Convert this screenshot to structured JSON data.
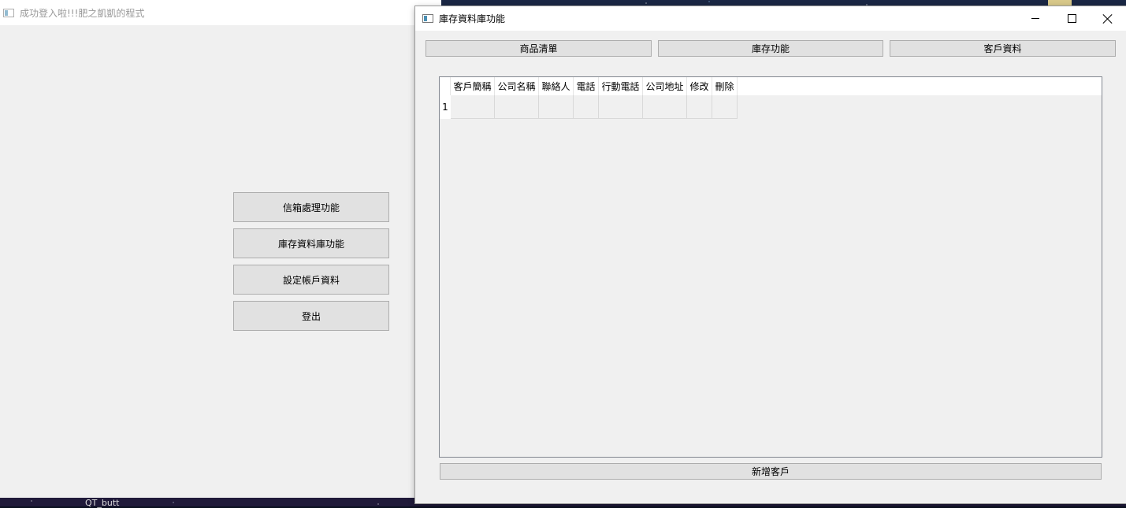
{
  "back_window": {
    "title": "成功登入啦!!!肥之凱凱的程式",
    "buttons": [
      "信箱處理功能",
      "庫存資料庫功能",
      "設定帳戶資料",
      "登出"
    ]
  },
  "front_window": {
    "title": "庫存資料庫功能",
    "tabs": [
      "商品清單",
      "庫存功能",
      "客戶資料"
    ],
    "table": {
      "columns": [
        "客戶簡稱",
        "公司名稱",
        "聯絡人",
        "電話",
        "行動電話",
        "公司地址",
        "修改",
        "刪除"
      ],
      "rows": [
        {
          "row_header": "1",
          "cells": [
            "",
            "",
            "",
            "",
            "",
            "",
            "",
            ""
          ]
        }
      ]
    },
    "add_button": "新增客戶"
  },
  "taskbar": {
    "fragments": [
      "QT_butt"
    ]
  },
  "colors": {
    "window_bg": "#f0f0f0",
    "button_bg": "#e1e1e1",
    "button_border": "#adadad",
    "titlebar_bg": "#ffffff"
  },
  "icons": [
    "app-window-icon",
    "minimize-icon",
    "maximize-icon",
    "close-icon"
  ]
}
